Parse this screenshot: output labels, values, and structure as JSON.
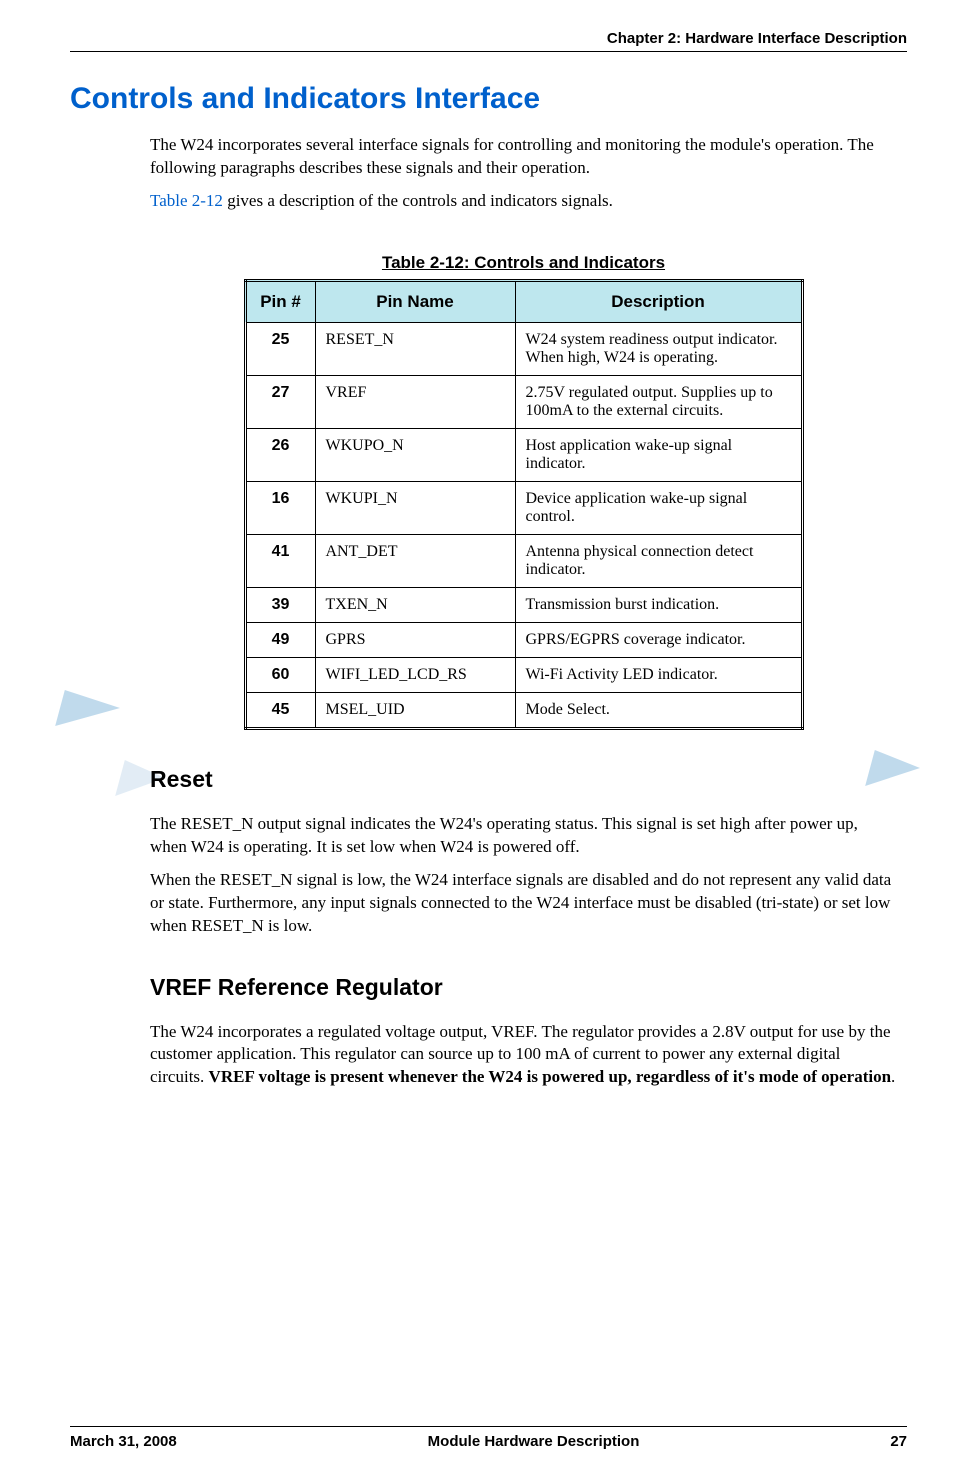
{
  "header": {
    "chapter": "Chapter 2:  Hardware Interface Description"
  },
  "section": {
    "title": "Controls and Indicators Interface",
    "paragraphs": [
      "The W24 incorporates several interface signals for controlling and monitoring the module's operation. The following paragraphs describes these signals and their operation.",
      "Table 2-12 gives a description of the controls and indicators signals."
    ],
    "table_ref": "Table 2-12",
    "para2_suffix": " gives a description of the controls and indicators signals."
  },
  "table": {
    "title": "Table 2-12: Controls and Indicators",
    "headers": {
      "pin": "Pin #",
      "name": "Pin Name",
      "desc": "Description"
    },
    "rows": [
      {
        "pin": "25",
        "name": "RESET_N",
        "desc": "W24 system readiness output indicator. When high, W24 is operating."
      },
      {
        "pin": "27",
        "name": "VREF",
        "desc": "2.75V regulated output. Supplies up to 100mA to the external circuits."
      },
      {
        "pin": "26",
        "name": "WKUPO_N",
        "desc": "Host application wake-up signal indicator."
      },
      {
        "pin": "16",
        "name": "WKUPI_N",
        "desc": "Device application wake-up signal control."
      },
      {
        "pin": "41",
        "name": "ANT_DET",
        "desc": "Antenna physical connection detect indicator."
      },
      {
        "pin": "39",
        "name": "TXEN_N",
        "desc": "Transmission burst indication."
      },
      {
        "pin": "49",
        "name": "GPRS",
        "desc": "GPRS/EGPRS coverage indicator."
      },
      {
        "pin": "60",
        "name": "WIFI_LED_LCD_RS",
        "desc": "Wi-Fi Activity LED indicator."
      },
      {
        "pin": "45",
        "name": "MSEL_UID",
        "desc": "Mode Select."
      }
    ]
  },
  "reset": {
    "title": "Reset",
    "p1": "The RESET_N output signal indicates the W24's operating status. This signal is set high after power up, when W24 is operating. It is set low when W24 is powered off.",
    "p2": "When the RESET_N signal is low, the W24 interface signals are disabled and do not represent any valid data or state. Furthermore, any input signals connected to the W24 interface must be disabled (tri-state) or set low when RESET_N is low."
  },
  "vref": {
    "title": "VREF Reference Regulator",
    "p1_pre": "The W24 incorporates a regulated voltage output, VREF. The regulator provides a 2.8V output for use by the customer application. This regulator can source up to 100 mA of current to power any external digital circuits. ",
    "p1_bold": "VREF voltage is present whenever the W24 is powered up, regardless of it's mode of operation",
    "p1_post": "."
  },
  "footer": {
    "date": "March 31, 2008",
    "title": "Module Hardware Description",
    "page": "27"
  }
}
